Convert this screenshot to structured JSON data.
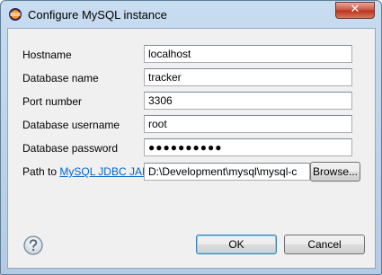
{
  "window": {
    "title": "Configure MySQL instance",
    "close_glyph": "✕"
  },
  "form": {
    "hostname": {
      "label": "Hostname",
      "value": "localhost"
    },
    "database_name": {
      "label": "Database name",
      "value": "tracker"
    },
    "port_number": {
      "label": "Port number",
      "value": "3306"
    },
    "database_username": {
      "label": "Database username",
      "value": "root"
    },
    "database_password": {
      "label": "Database password",
      "value": "●●●●●●●●●●"
    },
    "jdbc_path": {
      "label_prefix": "Path to ",
      "label_link": "MySQL JDBC JAR",
      "value": "D:\\Development\\mysql\\mysql-c",
      "browse_label": "Browse..."
    }
  },
  "buttons": {
    "ok_label": "OK",
    "cancel_label": "Cancel"
  },
  "icons": {
    "app": "eclipse-icon",
    "help": "help-icon"
  },
  "colors": {
    "link": "#0066cc",
    "close_button": "#c9503c",
    "title_bar": "#c8dcf0",
    "dialog_background": "#f0f0f0"
  }
}
